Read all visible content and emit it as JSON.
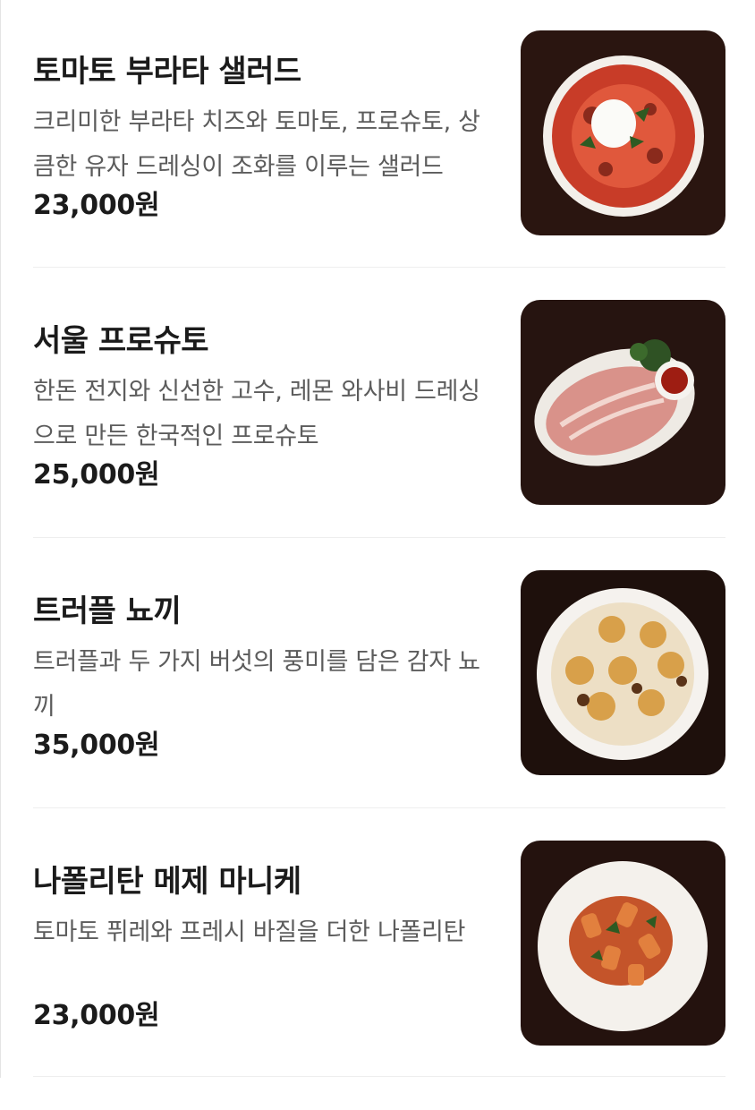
{
  "menu": {
    "items": [
      {
        "name": "토마토 부라타 샐러드",
        "description": "크리미한 부라타 치즈와 토마토, 프로슈토, 상큼한 유자 드레싱이 조화를 이루는 샐러드",
        "price": "23,000원"
      },
      {
        "name": "서울 프로슈토",
        "description": "한돈 전지와 신선한 고수, 레몬 와사비 드레싱으로 만든 한국적인 프로슈토",
        "price": "25,000원"
      },
      {
        "name": "트러플 뇨끼",
        "description": "트러플과 두 가지 버섯의 풍미를 담은 감자 뇨끼",
        "price": "35,000원"
      },
      {
        "name": "나폴리탄 메제 마니케",
        "description": "토마토 퓌레와 프레시 바질을 더한 나폴리탄",
        "price": "23,000원"
      }
    ]
  }
}
